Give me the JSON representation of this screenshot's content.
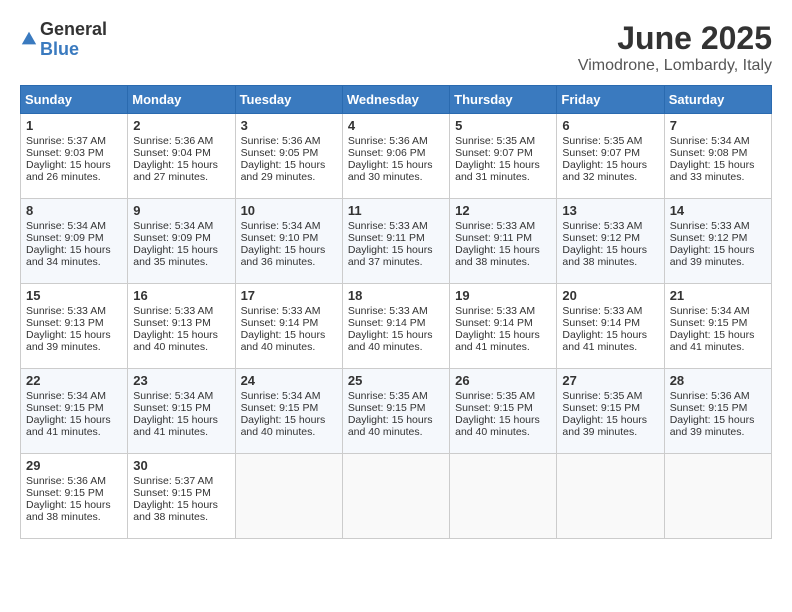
{
  "header": {
    "logo_general": "General",
    "logo_blue": "Blue",
    "month": "June 2025",
    "location": "Vimodrone, Lombardy, Italy"
  },
  "days_of_week": [
    "Sunday",
    "Monday",
    "Tuesday",
    "Wednesday",
    "Thursday",
    "Friday",
    "Saturday"
  ],
  "weeks": [
    [
      {
        "day": "1",
        "sunrise": "5:37 AM",
        "sunset": "9:03 PM",
        "daylight": "15 hours and 26 minutes."
      },
      {
        "day": "2",
        "sunrise": "5:36 AM",
        "sunset": "9:04 PM",
        "daylight": "15 hours and 27 minutes."
      },
      {
        "day": "3",
        "sunrise": "5:36 AM",
        "sunset": "9:05 PM",
        "daylight": "15 hours and 29 minutes."
      },
      {
        "day": "4",
        "sunrise": "5:36 AM",
        "sunset": "9:06 PM",
        "daylight": "15 hours and 30 minutes."
      },
      {
        "day": "5",
        "sunrise": "5:35 AM",
        "sunset": "9:07 PM",
        "daylight": "15 hours and 31 minutes."
      },
      {
        "day": "6",
        "sunrise": "5:35 AM",
        "sunset": "9:07 PM",
        "daylight": "15 hours and 32 minutes."
      },
      {
        "day": "7",
        "sunrise": "5:34 AM",
        "sunset": "9:08 PM",
        "daylight": "15 hours and 33 minutes."
      }
    ],
    [
      {
        "day": "8",
        "sunrise": "5:34 AM",
        "sunset": "9:09 PM",
        "daylight": "15 hours and 34 minutes."
      },
      {
        "day": "9",
        "sunrise": "5:34 AM",
        "sunset": "9:09 PM",
        "daylight": "15 hours and 35 minutes."
      },
      {
        "day": "10",
        "sunrise": "5:34 AM",
        "sunset": "9:10 PM",
        "daylight": "15 hours and 36 minutes."
      },
      {
        "day": "11",
        "sunrise": "5:33 AM",
        "sunset": "9:11 PM",
        "daylight": "15 hours and 37 minutes."
      },
      {
        "day": "12",
        "sunrise": "5:33 AM",
        "sunset": "9:11 PM",
        "daylight": "15 hours and 38 minutes."
      },
      {
        "day": "13",
        "sunrise": "5:33 AM",
        "sunset": "9:12 PM",
        "daylight": "15 hours and 38 minutes."
      },
      {
        "day": "14",
        "sunrise": "5:33 AM",
        "sunset": "9:12 PM",
        "daylight": "15 hours and 39 minutes."
      }
    ],
    [
      {
        "day": "15",
        "sunrise": "5:33 AM",
        "sunset": "9:13 PM",
        "daylight": "15 hours and 39 minutes."
      },
      {
        "day": "16",
        "sunrise": "5:33 AM",
        "sunset": "9:13 PM",
        "daylight": "15 hours and 40 minutes."
      },
      {
        "day": "17",
        "sunrise": "5:33 AM",
        "sunset": "9:14 PM",
        "daylight": "15 hours and 40 minutes."
      },
      {
        "day": "18",
        "sunrise": "5:33 AM",
        "sunset": "9:14 PM",
        "daylight": "15 hours and 40 minutes."
      },
      {
        "day": "19",
        "sunrise": "5:33 AM",
        "sunset": "9:14 PM",
        "daylight": "15 hours and 41 minutes."
      },
      {
        "day": "20",
        "sunrise": "5:33 AM",
        "sunset": "9:14 PM",
        "daylight": "15 hours and 41 minutes."
      },
      {
        "day": "21",
        "sunrise": "5:34 AM",
        "sunset": "9:15 PM",
        "daylight": "15 hours and 41 minutes."
      }
    ],
    [
      {
        "day": "22",
        "sunrise": "5:34 AM",
        "sunset": "9:15 PM",
        "daylight": "15 hours and 41 minutes."
      },
      {
        "day": "23",
        "sunrise": "5:34 AM",
        "sunset": "9:15 PM",
        "daylight": "15 hours and 41 minutes."
      },
      {
        "day": "24",
        "sunrise": "5:34 AM",
        "sunset": "9:15 PM",
        "daylight": "15 hours and 40 minutes."
      },
      {
        "day": "25",
        "sunrise": "5:35 AM",
        "sunset": "9:15 PM",
        "daylight": "15 hours and 40 minutes."
      },
      {
        "day": "26",
        "sunrise": "5:35 AM",
        "sunset": "9:15 PM",
        "daylight": "15 hours and 40 minutes."
      },
      {
        "day": "27",
        "sunrise": "5:35 AM",
        "sunset": "9:15 PM",
        "daylight": "15 hours and 39 minutes."
      },
      {
        "day": "28",
        "sunrise": "5:36 AM",
        "sunset": "9:15 PM",
        "daylight": "15 hours and 39 minutes."
      }
    ],
    [
      {
        "day": "29",
        "sunrise": "5:36 AM",
        "sunset": "9:15 PM",
        "daylight": "15 hours and 38 minutes."
      },
      {
        "day": "30",
        "sunrise": "5:37 AM",
        "sunset": "9:15 PM",
        "daylight": "15 hours and 38 minutes."
      },
      null,
      null,
      null,
      null,
      null
    ]
  ]
}
